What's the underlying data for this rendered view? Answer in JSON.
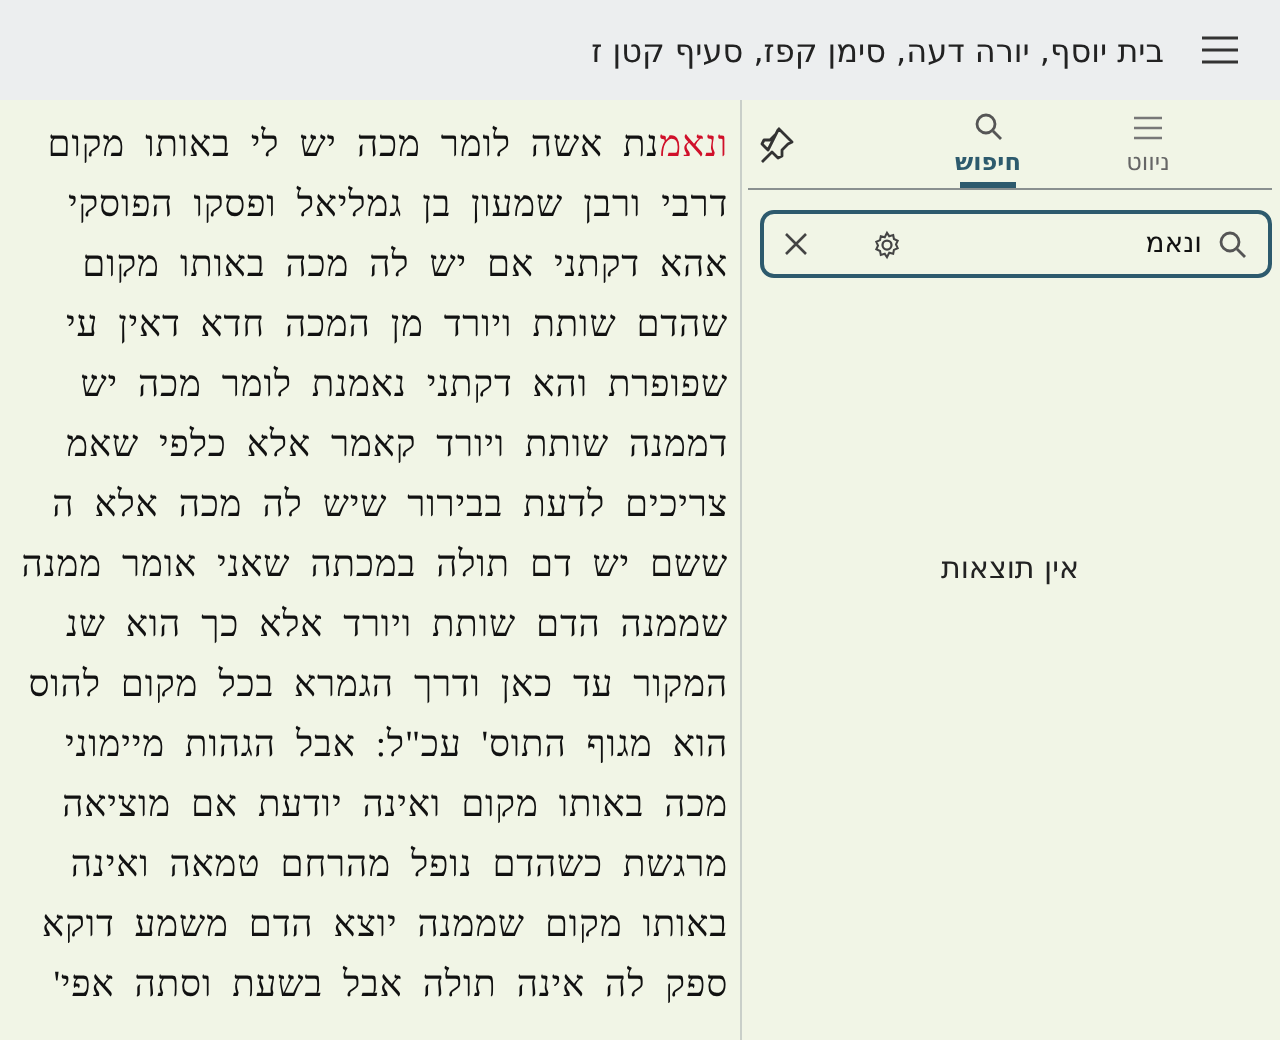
{
  "header": {
    "title": "בית יוסף, יורה דעה, סימן קפז, סעיף קטן ז"
  },
  "text_lines": [
    [
      {
        "text": "ונאמ",
        "highlighted": true
      },
      {
        "text": "נת אשה לומר מכה יש לי באותו מקום",
        "highlighted": false
      }
    ],
    [
      {
        "text": "דרבי ורבן שמעון בן גמליאל ופסקו הפוסקי",
        "highlighted": false
      }
    ],
    [
      {
        "text": "אהא דקתני אם יש לה מכה באותו מקום",
        "highlighted": false
      }
    ],
    [
      {
        "text": "שהדם שותת ויורד מן המכה חדא דאין עי",
        "highlighted": false
      }
    ],
    [
      {
        "text": "שפופרת והא דקתני נאמנת לומר מכה יש",
        "highlighted": false
      }
    ],
    [
      {
        "text": "דממנה שותת ויורד קאמר אלא כלפי שאמ",
        "highlighted": false
      }
    ],
    [
      {
        "text": "צריכים לדעת בבירור שיש לה מכה אלא ה",
        "highlighted": false
      }
    ],
    [
      {
        "text": "ששם יש דם תולה במכתה שאני אומר ממנה",
        "highlighted": false
      }
    ],
    [
      {
        "text": "שממנה הדם שותת ויורד אלא כך הוא שנ",
        "highlighted": false
      }
    ],
    [
      {
        "text": "המקור עד כאן ודרך הגמרא בכל מקום להוס",
        "highlighted": false
      }
    ],
    [
      {
        "text": "הוא מגוף התוס' עכ\"ל: אבל הגהות מיימוני",
        "highlighted": false
      }
    ],
    [
      {
        "text": "מכה באותו מקום ואינה יודעת אם מוציאה",
        "highlighted": false
      }
    ],
    [
      {
        "text": "מרגשת כשהדם נופל מהרחם טמאה ואינה",
        "highlighted": false
      }
    ],
    [
      {
        "text": "באותו מקום שממנה יוצא הדם משמע דוקא",
        "highlighted": false
      }
    ],
    [
      {
        "text": "ספק לה אינה תולה אבל בשעת וסתה אפי'",
        "highlighted": false
      }
    ]
  ],
  "side_panel": {
    "tabs": [
      {
        "label": "ניווט",
        "kind": "menu",
        "selected": false
      },
      {
        "label": "חיפוש",
        "kind": "search",
        "selected": true
      }
    ],
    "search": {
      "value": "ונאמ"
    },
    "empty_message": "אין תוצאות"
  }
}
